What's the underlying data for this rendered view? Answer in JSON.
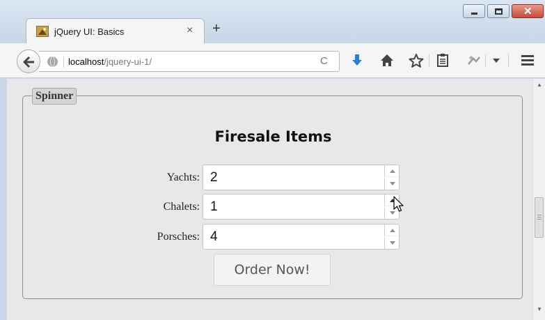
{
  "window": {
    "tab_title": "jQuery UI: Basics",
    "tab_close_glyph": "×",
    "new_tab_glyph": "+",
    "close_glyph": "✕"
  },
  "navbar": {
    "url_host": "localhost",
    "url_path": "/jquery-ui-1/",
    "reload_glyph": "C",
    "icons": [
      "back-arrow-icon",
      "globe-icon",
      "reload-icon",
      "download-icon",
      "home-icon",
      "star-icon",
      "reading-list-icon",
      "addon-icon",
      "dropdown-icon",
      "hamburger-menu-icon"
    ]
  },
  "colors": {
    "download_arrow": "#2a7fd4",
    "page_background": "#e8e8e8"
  },
  "page": {
    "legend": "Spinner",
    "title": "Firesale Items",
    "fields": [
      {
        "label": "Yachts:",
        "value": "2"
      },
      {
        "label": "Chalets:",
        "value": "1"
      },
      {
        "label": "Porsches:",
        "value": "4"
      }
    ],
    "order_button": "Order Now!"
  }
}
